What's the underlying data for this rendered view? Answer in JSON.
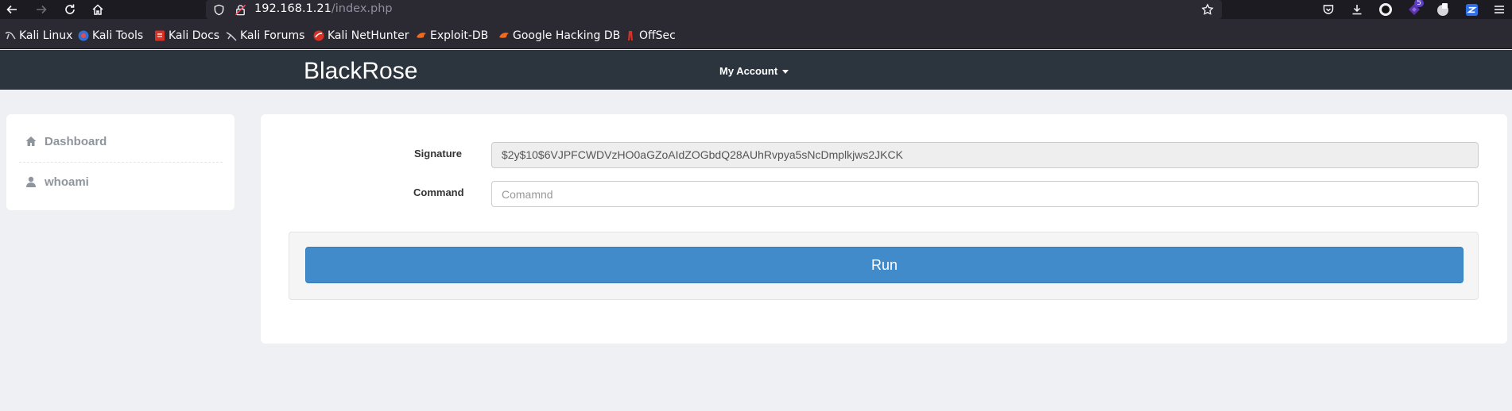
{
  "browser": {
    "url_host": "192.168.1.21",
    "url_path": "/index.php",
    "extension_badge": "5",
    "bookmarks": [
      {
        "label": "Kali Linux"
      },
      {
        "label": "Kali Tools"
      },
      {
        "label": "Kali Docs"
      },
      {
        "label": "Kali Forums"
      },
      {
        "label": "Kali NetHunter"
      },
      {
        "label": "Exploit-DB"
      },
      {
        "label": "Google Hacking DB"
      },
      {
        "label": "OffSec"
      }
    ]
  },
  "header": {
    "brand": "BlackRose",
    "account_menu": "My Account"
  },
  "sidebar": {
    "items": [
      {
        "label": "Dashboard",
        "icon": "home-icon"
      },
      {
        "label": "whoami",
        "icon": "user-icon"
      }
    ]
  },
  "form": {
    "signature_label": "Signature",
    "signature_value": "$2y$10$6VJPFCWDVzHO0aGZoAIdZOGbdQ28AUhRvpya5sNcDmplkjws2JKCK",
    "command_label": "Command",
    "command_placeholder": "Comamnd",
    "command_value": "",
    "run_label": "Run"
  },
  "colors": {
    "header_bg": "#2c353e",
    "run_button": "#428bca",
    "page_bg": "#eef0f4"
  }
}
